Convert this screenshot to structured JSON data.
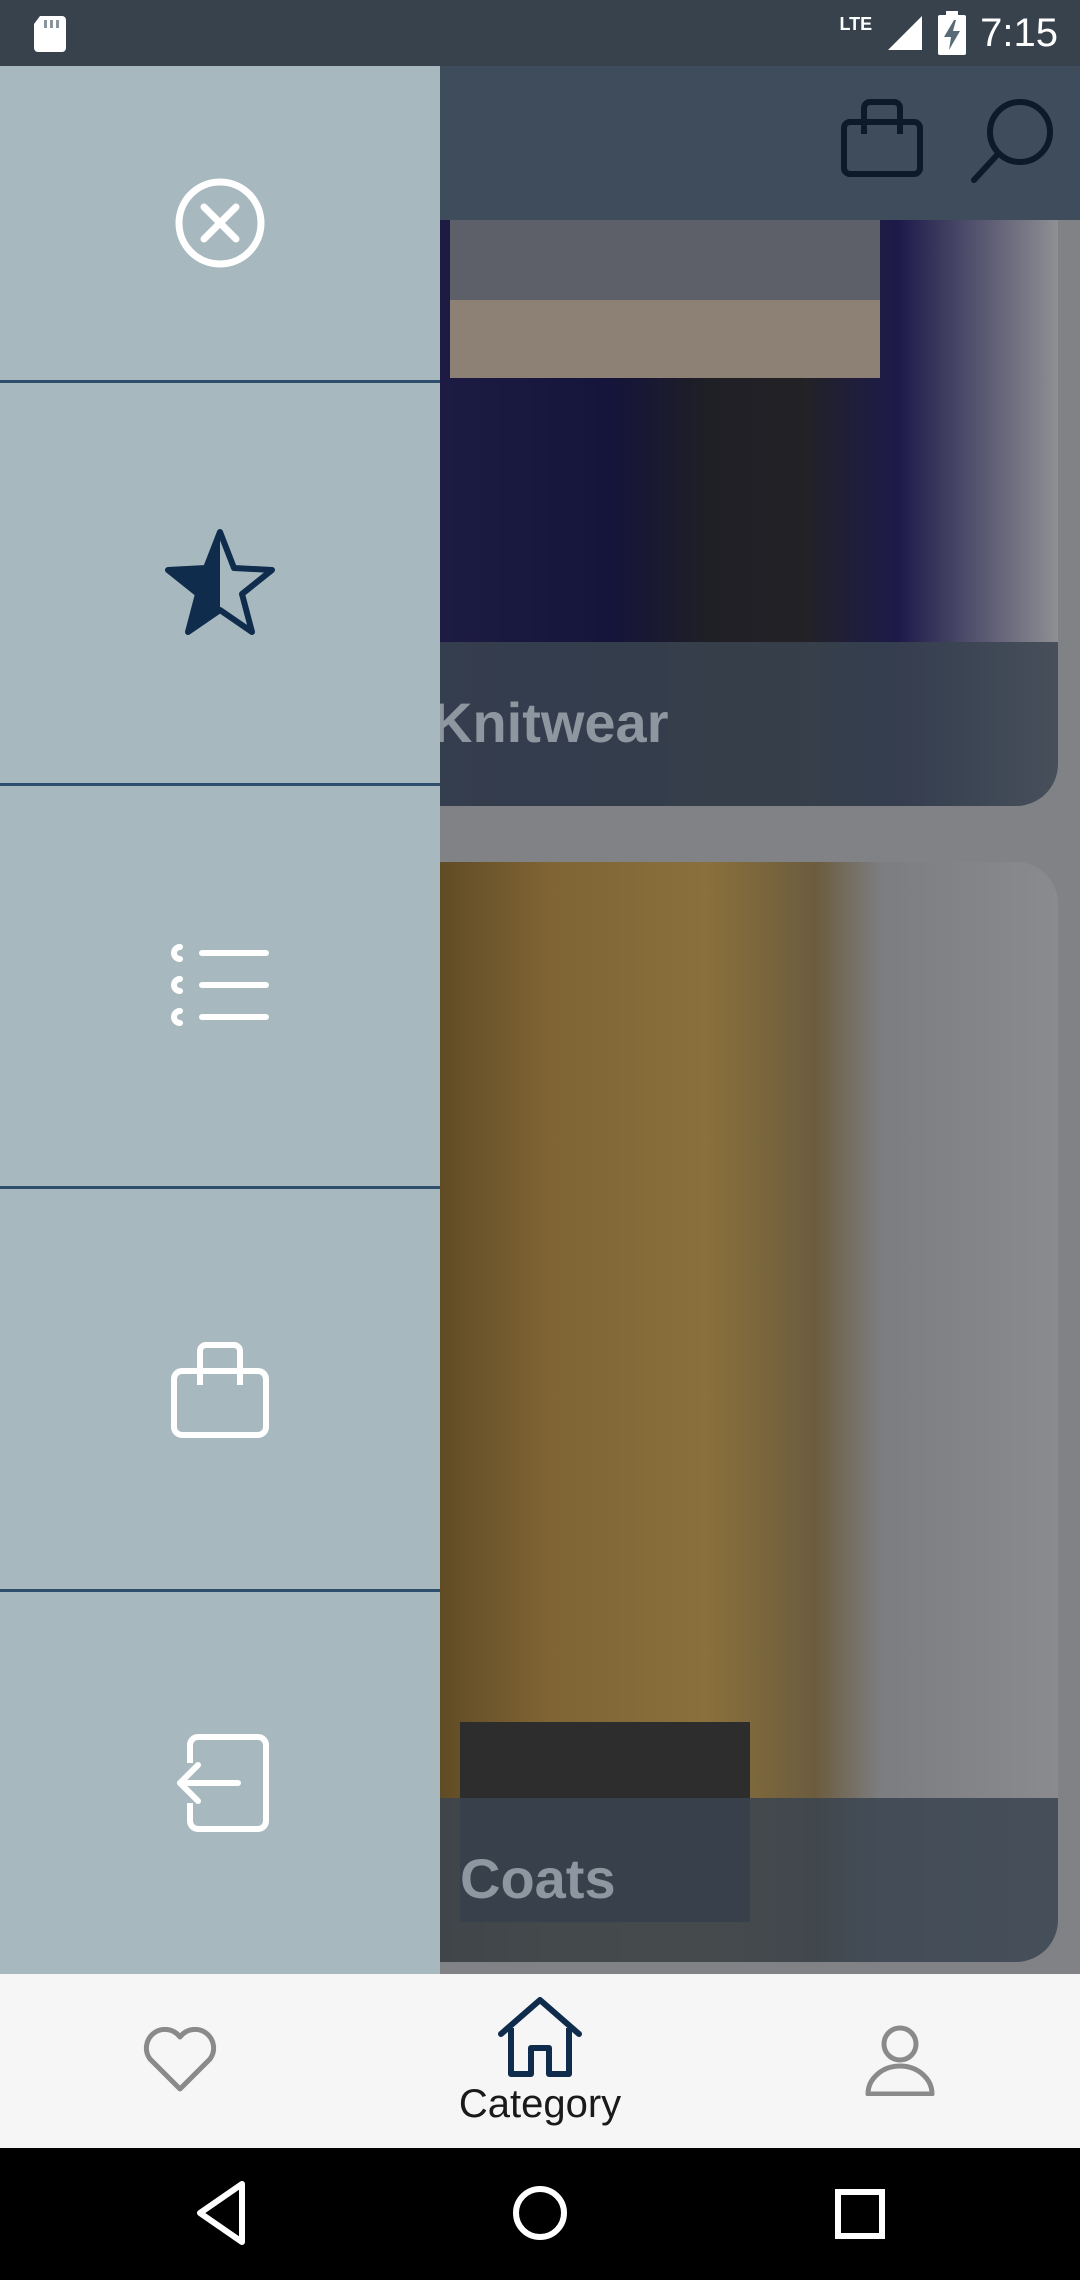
{
  "status_bar": {
    "time": "7:15",
    "network": "LTE",
    "icons": [
      "sd-card-icon",
      "signal-icon",
      "battery-charging-icon"
    ]
  },
  "app_bar": {
    "icons": [
      "shopping-bag-icon",
      "search-icon"
    ]
  },
  "categories": [
    {
      "label": "Knitwear"
    },
    {
      "label": "Coats"
    }
  ],
  "drawer": {
    "items": [
      {
        "icon": "close-icon"
      },
      {
        "icon": "star-half-icon"
      },
      {
        "icon": "list-icon"
      },
      {
        "icon": "shopping-bag-icon"
      },
      {
        "icon": "logout-icon"
      }
    ]
  },
  "bottom_nav": {
    "items": [
      {
        "icon": "heart-icon",
        "label": ""
      },
      {
        "icon": "home-icon",
        "label": "Category"
      },
      {
        "icon": "user-icon",
        "label": ""
      }
    ],
    "active_index": 1
  },
  "colors": {
    "drawer_bg": "#a7b8bf",
    "divider": "#2f4d6c",
    "accent": "#0f2c4d",
    "nav_bg": "#f6f6f6"
  }
}
